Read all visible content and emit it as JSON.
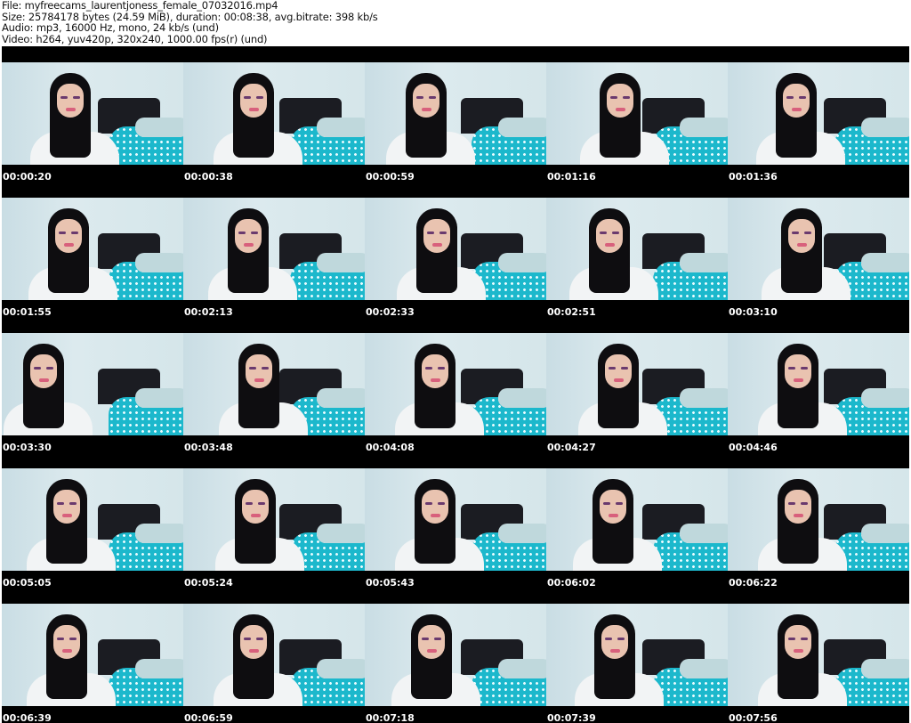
{
  "header": {
    "file": "File: myfreecams_laurentjoness_female_07032016.mp4",
    "size": "Size: 25784178 bytes (24.59 MiB), duration: 00:08:38, avg.bitrate: 398 kb/s",
    "audio": "Audio: mp3, 16000 Hz, mono, 24 kb/s (und)",
    "video": "Video: h264, yuv420p, 320x240, 1000.00 fps(r) (und)"
  },
  "thumbnails": [
    "00:00:20",
    "00:00:38",
    "00:00:59",
    "00:01:16",
    "00:01:36",
    "00:01:55",
    "00:02:13",
    "00:02:33",
    "00:02:51",
    "00:03:10",
    "00:03:30",
    "00:03:48",
    "00:04:08",
    "00:04:27",
    "00:04:46",
    "00:05:05",
    "00:05:24",
    "00:05:43",
    "00:06:02",
    "00:06:22",
    "00:06:39",
    "00:06:59",
    "00:07:18",
    "00:07:39",
    "00:07:56"
  ],
  "colors": {
    "background": "#000000",
    "wall": "#d5e6ea",
    "bedding": "#1cb8cc",
    "headboard": "#1b1c22"
  }
}
